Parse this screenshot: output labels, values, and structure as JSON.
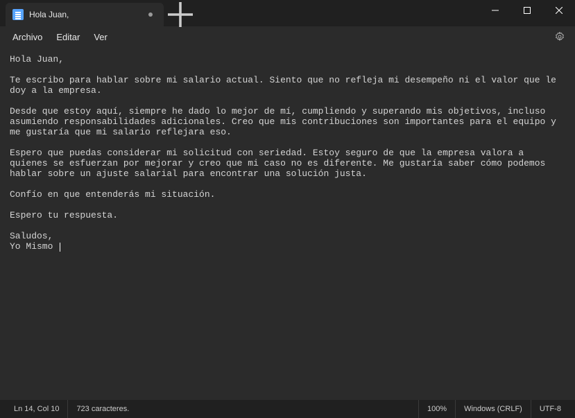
{
  "tab": {
    "title": "Hola Juan,"
  },
  "menu": {
    "file": "Archivo",
    "edit": "Editar",
    "view": "Ver"
  },
  "document": {
    "text": "Hola Juan,\n\nTe escribo para hablar sobre mi salario actual. Siento que no refleja mi desempeño ni el valor que le doy a la empresa.\n\nDesde que estoy aquí, siempre he dado lo mejor de mí, cumpliendo y superando mis objetivos, incluso asumiendo responsabilidades adicionales. Creo que mis contribuciones son importantes para el equipo y me gustaría que mi salario reflejara eso.\n\nEspero que puedas considerar mi solicitud con seriedad. Estoy seguro de que la empresa valora a quienes se esfuerzan por mejorar y creo que mi caso no es diferente. Me gustaría saber cómo podemos hablar sobre un ajuste salarial para encontrar una solución justa.\n\nConfío en que entenderás mi situación.\n\nEspero tu respuesta.\n\nSaludos,\nYo Mismo "
  },
  "status": {
    "position": "Ln 14, Col 10",
    "chars": "723 caracteres.",
    "zoom": "100%",
    "eol": "Windows (CRLF)",
    "encoding": "UTF-8"
  }
}
